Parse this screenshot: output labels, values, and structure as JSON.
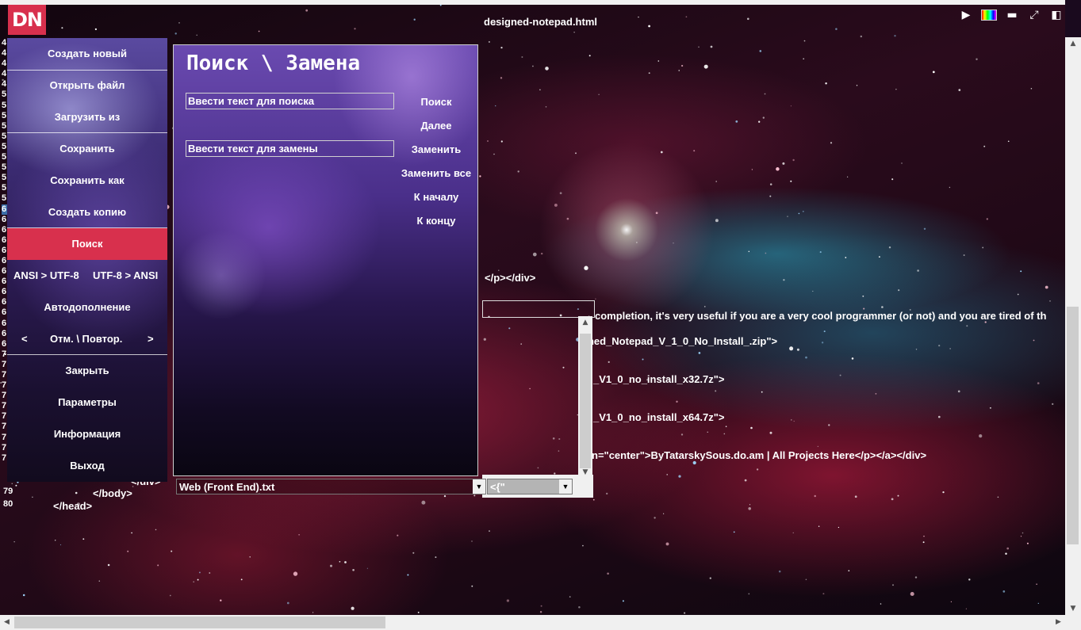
{
  "window": {
    "title": "designed-notepad.html",
    "logo": "DN",
    "icons": [
      "play-icon",
      "color-palette-icon",
      "minimize-icon",
      "fullscreen-icon",
      "restore-icon"
    ]
  },
  "menu": {
    "items": [
      {
        "id": "new",
        "label": "Создать новый"
      },
      {
        "id": "open",
        "label": "Открыть файл"
      },
      {
        "id": "load",
        "label": "Загрузить из"
      },
      {
        "id": "save",
        "label": "Сохранить"
      },
      {
        "id": "save_as",
        "label": "Сохранить как"
      },
      {
        "id": "copy",
        "label": "Создать копию"
      },
      {
        "id": "search",
        "label": "Поиск"
      },
      {
        "id": "autocomplete",
        "label": "Автодополнение"
      },
      {
        "id": "close",
        "label": "Закрыть"
      },
      {
        "id": "params",
        "label": "Параметры"
      },
      {
        "id": "info",
        "label": "Информация"
      },
      {
        "id": "exit",
        "label": "Выход"
      }
    ],
    "ansi_utf8": "ANSI > UTF-8",
    "utf8_ansi": "UTF-8 > ANSI",
    "undo_redo": "Отм. \\ Повтор.",
    "prev": "<",
    "next": ">",
    "active": "Поиск"
  },
  "search_panel": {
    "title": "Поиск \\ Замена",
    "search_placeholder": "Ввести текст для поиска",
    "replace_placeholder": "Ввести текст для замены",
    "buttons": {
      "find": "Поиск",
      "next": "Далее",
      "replace": "Заменить",
      "replace_all": "Заменить все",
      "to_start": "К началу",
      "to_end": "К концу"
    }
  },
  "editor": {
    "gutter_top": [
      "4",
      "4",
      "4",
      "4",
      "4",
      "5",
      "5",
      "5",
      "5",
      "5",
      "5",
      "5",
      "5",
      "5",
      "5",
      "5",
      "6",
      "6",
      "6",
      "6",
      "6",
      "6",
      "6",
      "6",
      "6",
      "6",
      "6",
      "6",
      "6",
      "6",
      "7",
      "7",
      "7",
      "7",
      "7",
      "7",
      "7",
      "7",
      "7",
      "7",
      "7"
    ],
    "gutter_bottom": [
      "79",
      "80"
    ],
    "lines": {
      "l1": "</p></div>",
      "l2": "completion, it's very useful if you are a very cool programmer (or not) and you are tired of th",
      "l3": "gned_Notepad_V_1_0_No_Install_.zip\">",
      "l4": "_V1_0_no_install_x32.7z\">",
      "l5": "_V1_0_no_install_x64.7z\">",
      "l6": "n=\"center\">ByTatarskySous.do.am | All Projects Here</p></a></div>",
      "l7": "</div>",
      "l8": "</body>",
      "l9": "</head>"
    }
  },
  "footer_controls": {
    "syntax_file": "Web (Front End).txt",
    "autocomplete_token": "<{\""
  }
}
